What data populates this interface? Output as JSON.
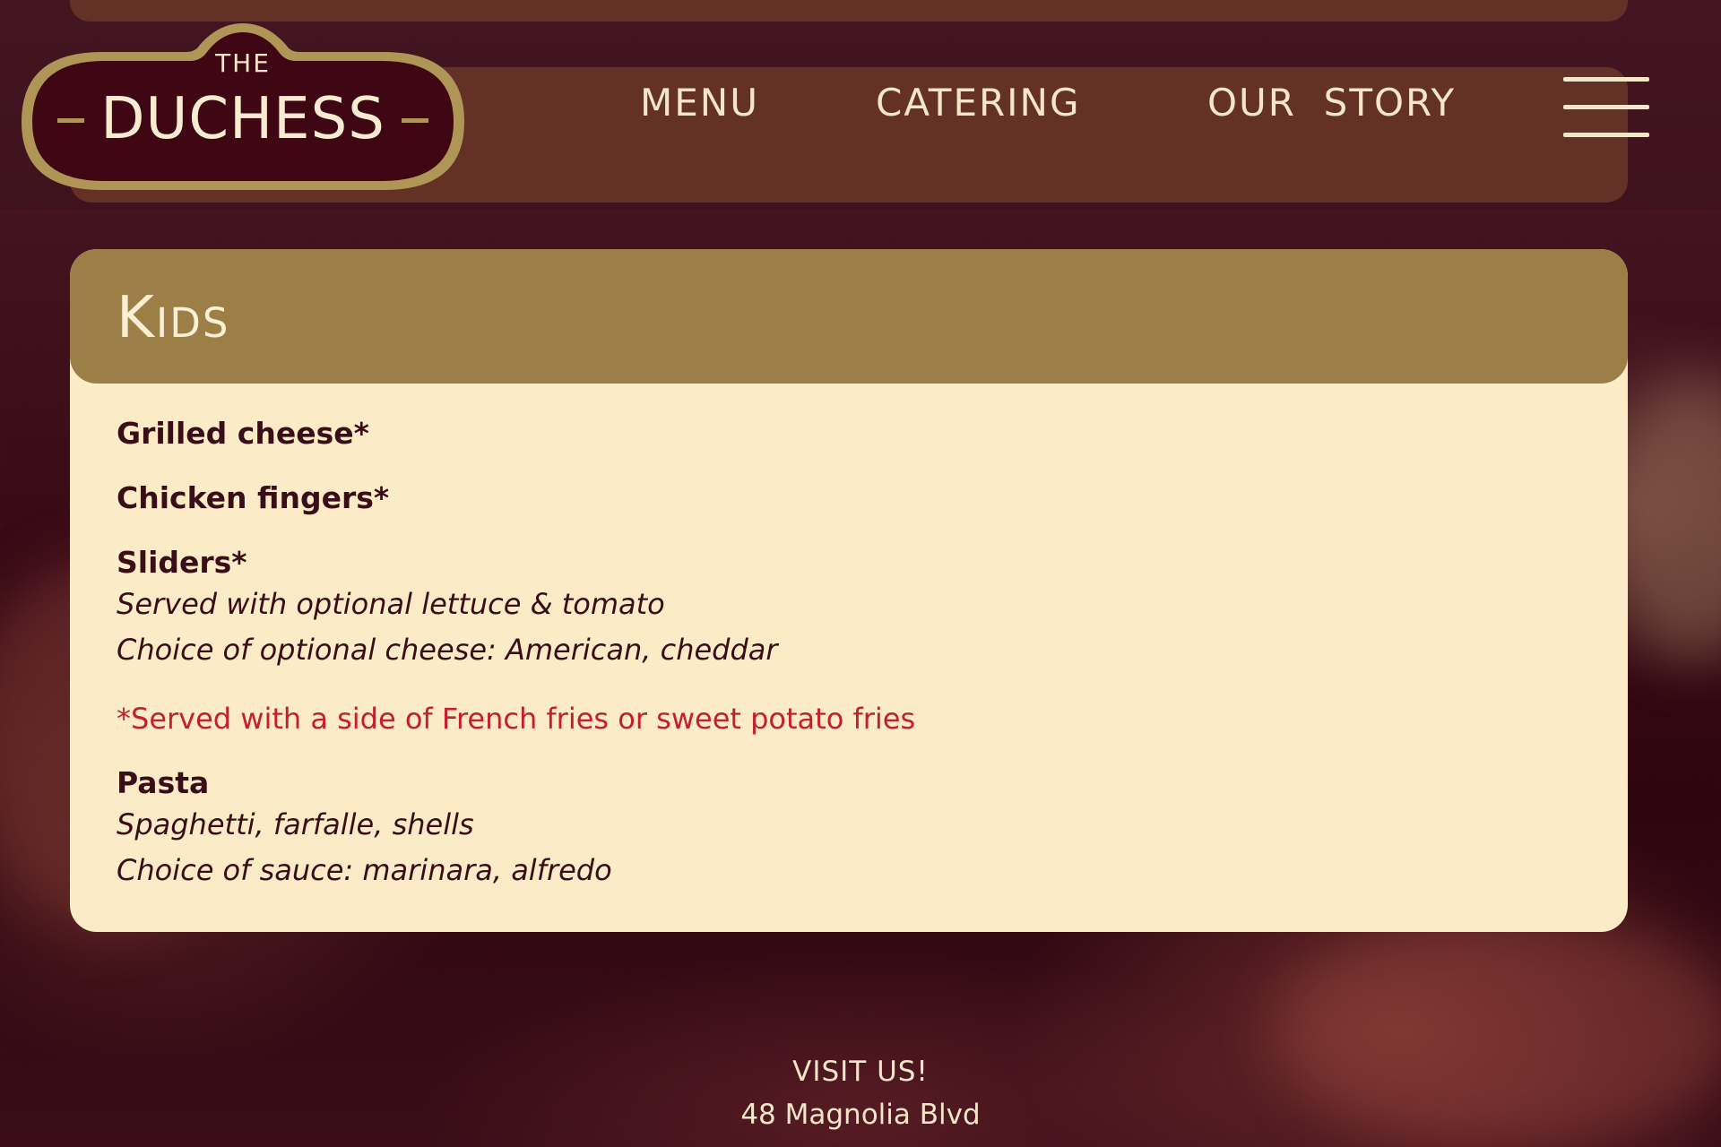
{
  "brand": {
    "small": "THE",
    "name": "DUCHESS"
  },
  "nav": {
    "links": [
      {
        "label": "MENU"
      },
      {
        "label": "CATERING"
      },
      {
        "label": "OUR  STORY"
      }
    ],
    "hamburger_icon": "hamburger-menu-icon"
  },
  "section": {
    "title": "Kids",
    "items": [
      {
        "name": "Grilled cheese*"
      },
      {
        "name": "Chicken fingers*"
      },
      {
        "name": "Sliders*",
        "desc": [
          "Served with optional lettuce & tomato",
          "Choice of optional cheese: American, cheddar"
        ]
      }
    ],
    "note": "*Served with a side of French fries or sweet potato fries",
    "pasta": {
      "name": "Pasta",
      "desc": [
        "Spaghetti, farfalle, shells",
        "Choice of sauce: marinara, alfredo"
      ]
    }
  },
  "footer": {
    "title": "VISIT US!",
    "address": "48 Magnolia Blvd"
  },
  "colors": {
    "header_brown": "#643127",
    "gold": "#9b7f47",
    "cream": "#fcebc7",
    "maroon": "#3a0e18",
    "note_red": "#c4202a"
  }
}
